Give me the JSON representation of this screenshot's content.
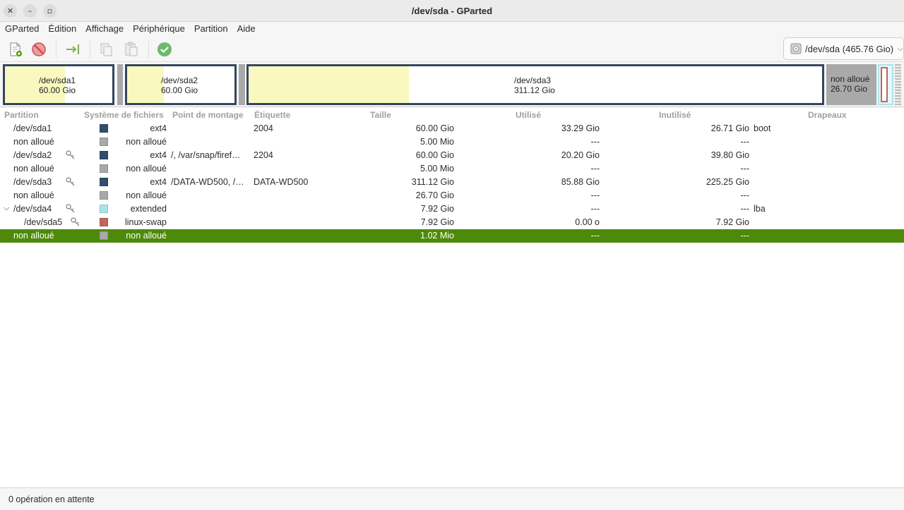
{
  "window": {
    "title": "/dev/sda - GParted",
    "controls": [
      "close",
      "minimize",
      "maximize"
    ]
  },
  "menu": [
    "GParted",
    "Édition",
    "Affichage",
    "Périphérique",
    "Partition",
    "Aide"
  ],
  "toolbar": {
    "buttons": [
      "new-partition",
      "delete",
      "resize-move",
      "copy",
      "paste",
      "apply"
    ],
    "device": "/dev/sda (465.76 Gio)"
  },
  "diskmap": {
    "sda1": {
      "name": "/dev/sda1",
      "size": "60.00 Gio",
      "used_fraction": 0.555
    },
    "sda2": {
      "name": "/dev/sda2",
      "size": "60.00 Gio",
      "used_fraction": 0.337
    },
    "sda3": {
      "name": "/dev/sda3",
      "size": "311.12 Gio",
      "used_fraction": 0.276
    },
    "unalloc": {
      "name": "non alloué",
      "size": "26.70 Gio"
    }
  },
  "columns": {
    "partition": "Partition",
    "fs": "Système de fichiers",
    "mount": "Point de montage",
    "label": "Étiquette",
    "size": "Taille",
    "used": "Utilisé",
    "unused": "Inutilisé",
    "flags": "Drapeaux"
  },
  "rows": [
    {
      "partition": "/dev/sda1",
      "fs": "ext4",
      "color": "#314e6c",
      "mount": "",
      "label": "2004",
      "size": "60.00 Gio",
      "used": "33.29 Gio",
      "unused": "26.71 Gio",
      "flags": "boot"
    },
    {
      "partition": "non alloué",
      "fs": "non alloué",
      "color": "#a9a9a9",
      "mount": "",
      "label": "",
      "size": "5.00 Mio",
      "used": "---",
      "unused": "---",
      "flags": ""
    },
    {
      "partition": "/dev/sda2",
      "fs": "ext4",
      "color": "#314e6c",
      "mount": "/, /var/snap/firef…",
      "label": "2204",
      "size": "60.00 Gio",
      "used": "20.20 Gio",
      "unused": "39.80 Gio",
      "flags": ""
    },
    {
      "partition": "non alloué",
      "fs": "non alloué",
      "color": "#a9a9a9",
      "mount": "",
      "label": "",
      "size": "5.00 Mio",
      "used": "---",
      "unused": "---",
      "flags": ""
    },
    {
      "partition": "/dev/sda3",
      "fs": "ext4",
      "color": "#314e6c",
      "mount": "/DATA-WD500, /…",
      "label": "DATA-WD500",
      "size": "311.12 Gio",
      "used": "85.88 Gio",
      "unused": "225.25 Gio",
      "flags": ""
    },
    {
      "partition": "non alloué",
      "fs": "non alloué",
      "color": "#a9a9a9",
      "mount": "",
      "label": "",
      "size": "26.70 Gio",
      "used": "---",
      "unused": "---",
      "flags": ""
    },
    {
      "partition": "/dev/sda4",
      "fs": "extended",
      "color": "#a8e4e8",
      "mount": "",
      "label": "",
      "size": "7.92 Gio",
      "used": "---",
      "unused": "---",
      "flags": "lba"
    },
    {
      "partition": "/dev/sda5",
      "fs": "linux-swap",
      "color": "#c1665a",
      "mount": "",
      "label": "",
      "size": "7.92 Gio",
      "used": "0.00 o",
      "unused": "7.92 Gio",
      "flags": ""
    },
    {
      "partition": "non alloué",
      "fs": "non alloué",
      "color": "#a9a9a9",
      "mount": "",
      "label": "",
      "size": "1.02 Mio",
      "used": "---",
      "unused": "---",
      "flags": ""
    }
  ],
  "status": "0 opération en attente",
  "colors": {
    "selection": "#4e8a09",
    "partition_border": "#34465e",
    "used_space": "#f8f8bf",
    "unallocated": "#a9a9a9"
  }
}
